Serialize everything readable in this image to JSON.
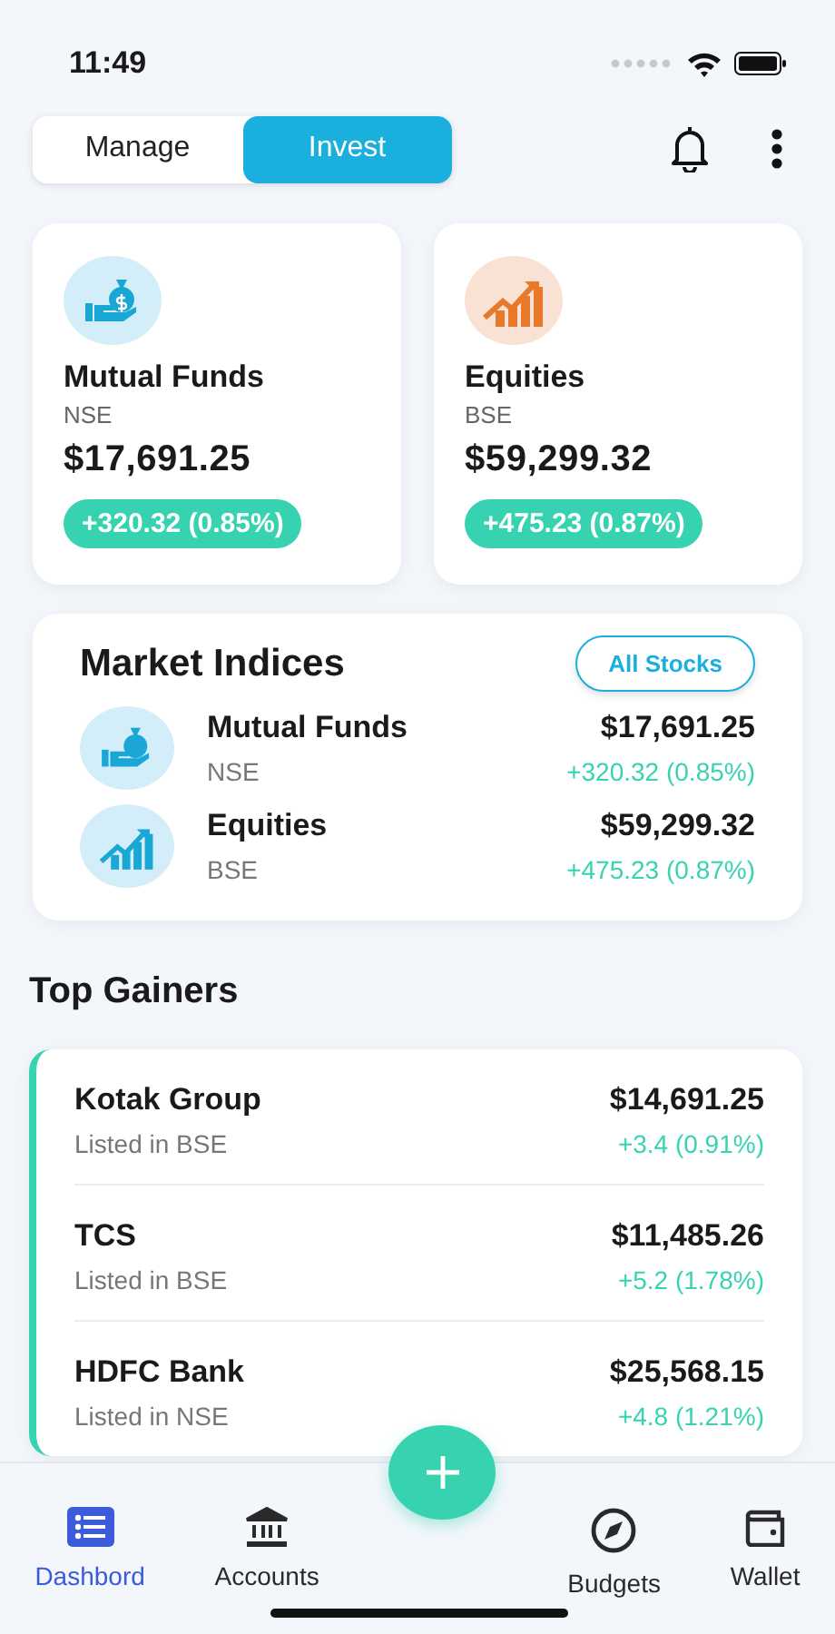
{
  "status_bar": {
    "time": "11:49"
  },
  "toggle": [
    {
      "label": "Manage",
      "selected": false
    },
    {
      "label": "Invest",
      "selected": true
    }
  ],
  "summary_cards": [
    {
      "kind": "funds",
      "name": "Mutual Funds",
      "exchange": "NSE",
      "value": "$17,691.25",
      "change": "+320.32 (0.85%)"
    },
    {
      "kind": "equities",
      "name": "Equities",
      "exchange": "BSE",
      "value": "$59,299.32",
      "change": "+475.23 (0.87%)"
    }
  ],
  "market_indices": {
    "title": "Market Indices",
    "button": "All Stocks",
    "rows": [
      {
        "kind": "funds",
        "name": "Mutual Funds",
        "exchange": "NSE",
        "value": "$17,691.25",
        "change": "+320.32 (0.85%)"
      },
      {
        "kind": "equities",
        "name": "Equities",
        "exchange": "BSE",
        "value": "$59,299.32",
        "change": "+475.23 (0.87%)"
      }
    ]
  },
  "top_gainers": {
    "title": "Top Gainers",
    "rows": [
      {
        "name": "Kotak Group",
        "listing": "Listed in BSE",
        "value": "$14,691.25",
        "change": "+3.4 (0.91%)"
      },
      {
        "name": "TCS",
        "listing": "Listed in BSE",
        "value": "$11,485.26",
        "change": "+5.2 (1.78%)"
      },
      {
        "name": "HDFC Bank",
        "listing": "Listed in NSE",
        "value": "$25,568.15",
        "change": "+4.8 (1.21%)"
      }
    ]
  },
  "nav": [
    {
      "kind": "list",
      "label": "Dashbord",
      "selected": true
    },
    {
      "kind": "bank",
      "label": "Accounts",
      "selected": false
    },
    {
      "kind": "fab"
    },
    {
      "kind": "compass",
      "label": "Budgets",
      "selected": false
    },
    {
      "kind": "wallet",
      "label": "Wallet",
      "selected": false
    }
  ]
}
